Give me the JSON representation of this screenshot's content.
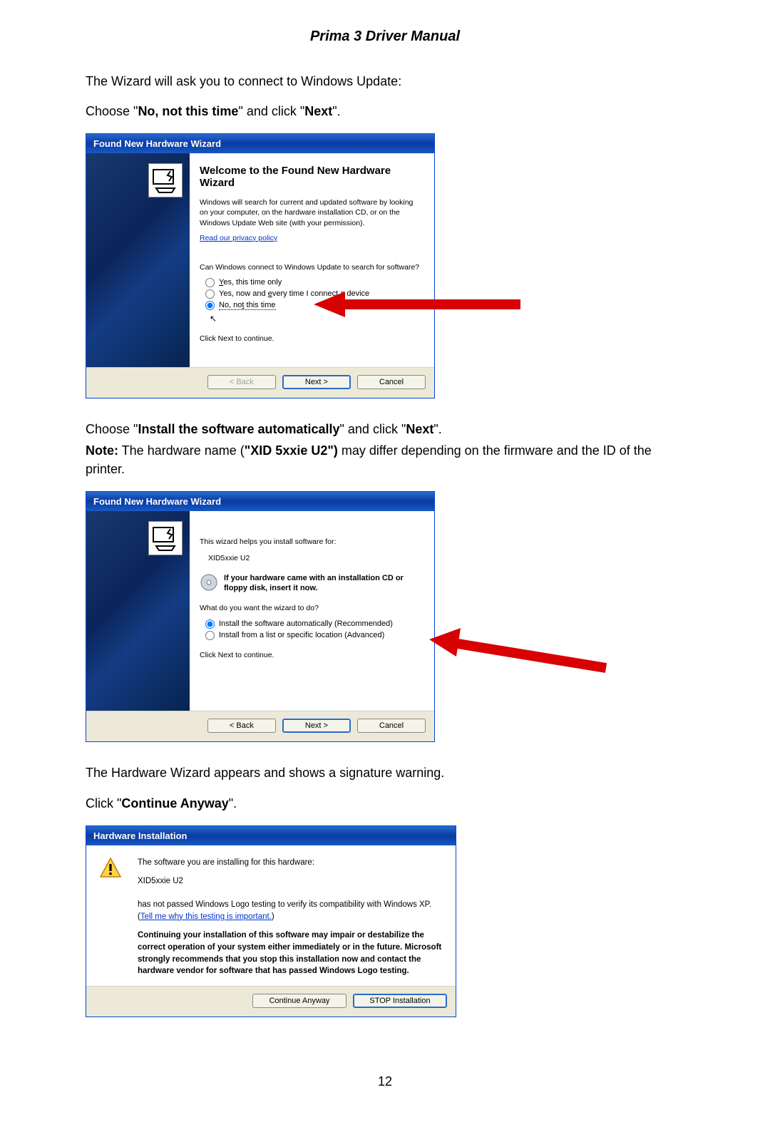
{
  "page_title": "Prima 3 Driver Manual",
  "page_number": "12",
  "intro_lines": {
    "l1": "The Wizard will ask you to connect to Windows Update:",
    "l2a": "Choose \"",
    "l2b": "No, not this time",
    "l2c": "\" and click \"",
    "l2d": "Next",
    "l2e": "\"."
  },
  "section2": {
    "l1a": "Choose \"",
    "l1b": "Install the software automatically",
    "l1c": "\" and click \"",
    "l1d": "Next",
    "l1e": "\".",
    "note_label": "Note:",
    "note_body_a": " The hardware name (",
    "note_body_b": "\"XID 5xxie U2\")",
    "note_body_c": " may differ depending on the firmware and the ID of the printer."
  },
  "section3": {
    "l1": "The Hardware Wizard appears and shows a signature warning.",
    "l2a": "Click \"",
    "l2b": "Continue Anyway",
    "l2c": "\"."
  },
  "wizard1": {
    "title": "Found New Hardware Wizard",
    "heading": "Welcome to the Found New Hardware Wizard",
    "desc": "Windows will search for current and updated software by looking on your computer, on the hardware installation CD, or on the Windows Update Web site (with your permission).",
    "privacy": "Read our privacy policy",
    "prompt": "Can Windows connect to Windows Update to search for software?",
    "opt1": "Yes, this time only",
    "opt2": "Yes, now and every time I connect a device",
    "opt3": "No, not this time",
    "continue": "Click Next to continue.",
    "buttons": {
      "back": "< Back",
      "next": "Next >",
      "cancel": "Cancel"
    }
  },
  "wizard2": {
    "title": "Found New Hardware Wizard",
    "line1": "This wizard helps you install software for:",
    "device": "XID5xxie U2",
    "cd_hint": "If your hardware came with an installation CD or floppy disk, insert it now.",
    "prompt": "What do you want the wizard to do?",
    "opt1": "Install the software automatically (Recommended)",
    "opt2": "Install from a list or specific location (Advanced)",
    "continue": "Click Next to continue.",
    "buttons": {
      "back": "< Back",
      "next": "Next >",
      "cancel": "Cancel"
    }
  },
  "warn": {
    "title": "Hardware Installation",
    "line1": "The software you are installing for this hardware:",
    "device": "XID5xxie U2",
    "line2a": "has not passed Windows Logo testing to verify its compatibility with Windows XP. (",
    "link": "Tell me why this testing is important.",
    "line2b": ")",
    "strong": "Continuing your installation of this software may impair or destabilize the correct operation of your system either immediately or in the future. Microsoft strongly recommends that you stop this installation now and contact the hardware vendor for software that has passed Windows Logo testing.",
    "buttons": {
      "cont": "Continue Anyway",
      "stop": "STOP Installation"
    }
  }
}
